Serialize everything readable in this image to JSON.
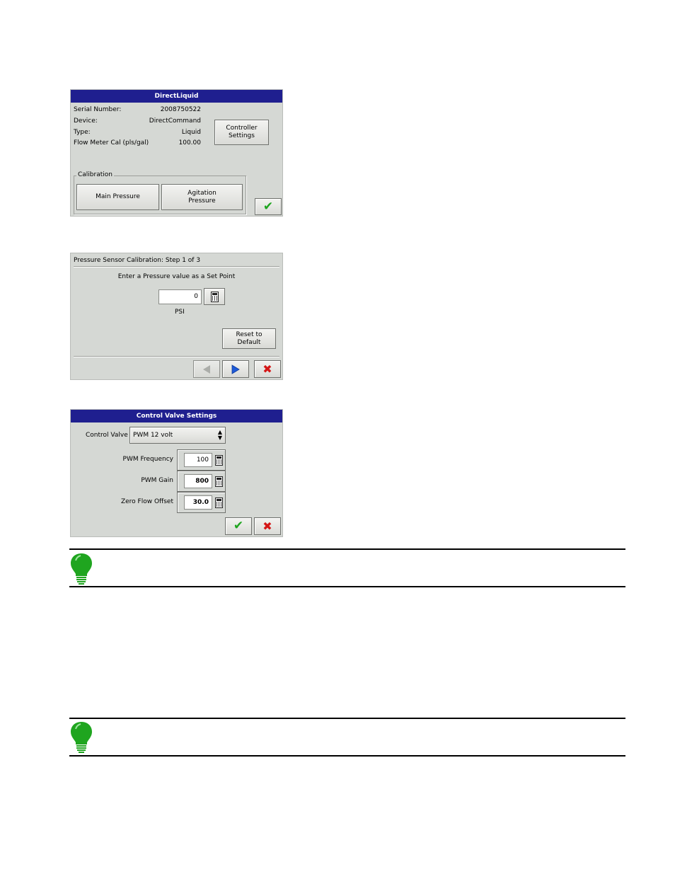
{
  "direct_liquid": {
    "title": "DirectLiquid",
    "rows": [
      {
        "label": "Serial Number:",
        "value": "2008750522"
      },
      {
        "label": "Device:",
        "value": "DirectCommand"
      },
      {
        "label": "Type:",
        "value": "Liquid"
      },
      {
        "label": "Flow Meter Cal (pls/gal)",
        "value": "100.00"
      }
    ],
    "controller_settings_label": "Controller Settings",
    "calibration_legend": "Calibration",
    "main_pressure_label": "Main Pressure",
    "agitation_pressure_label": "Agitation Pressure"
  },
  "pressure_calibration": {
    "title": "Pressure Sensor Calibration:  Step 1 of 3",
    "instruction": "Enter a Pressure value as a Set Point",
    "value": "0",
    "unit": "PSI",
    "reset_label": "Reset to Default"
  },
  "control_valve": {
    "title": "Control Valve Settings",
    "control_valve_label": "Control Valve",
    "control_valve_selected": "PWM 12 volt",
    "fields": [
      {
        "label": "PWM Frequency",
        "value": "100"
      },
      {
        "label": "PWM Gain",
        "value": "800"
      },
      {
        "label": "Zero Flow Offset",
        "value": "30.0"
      }
    ]
  },
  "icons": {
    "ok": "checkmark-icon",
    "cancel": "x-icon",
    "back": "left-arrow-icon",
    "next": "right-arrow-icon",
    "calculator": "calculator-icon",
    "note": "lightbulb-icon"
  },
  "colors": {
    "title_bar": "#1f1f8f",
    "panel_bg": "#d5d8d4",
    "ok_green": "#1ea51e",
    "cancel_red": "#d41616",
    "arrow_blue": "#1e5ad8",
    "bulb_green": "#1fa51f"
  }
}
